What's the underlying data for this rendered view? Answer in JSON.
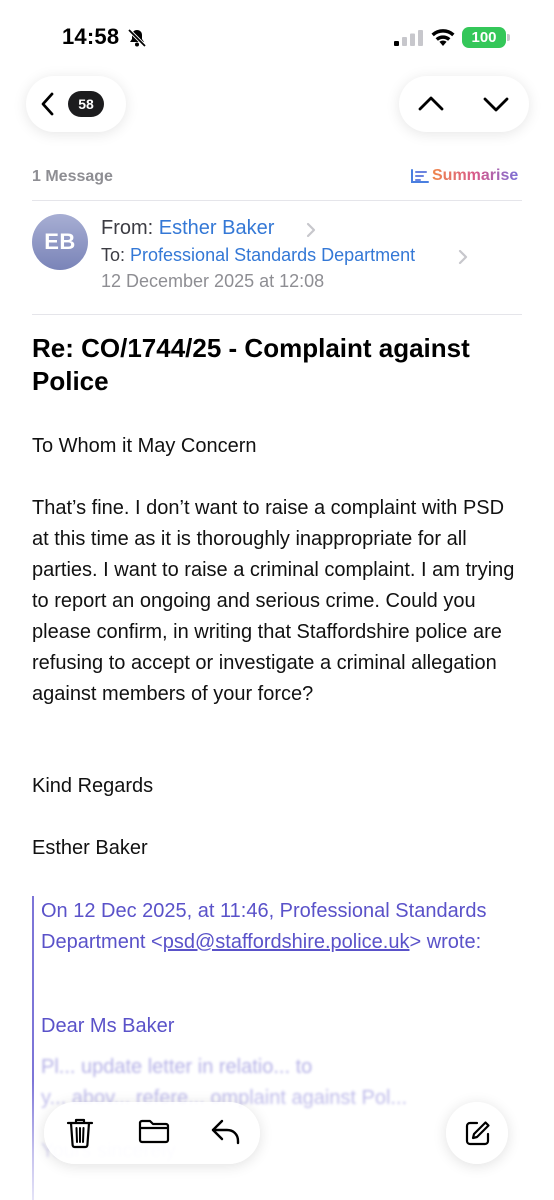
{
  "status_bar": {
    "time": "14:58",
    "battery": "100",
    "icons": [
      "bell-slash-icon",
      "cellular-signal-icon",
      "wifi-icon",
      "battery-icon"
    ],
    "battery_color": "#34c759"
  },
  "nav": {
    "unread_count": "58",
    "icons": [
      "chevron-left-icon",
      "chevron-up-icon",
      "chevron-down-icon"
    ]
  },
  "thread": {
    "message_count": "1 Message",
    "summarise_label": "Summarise"
  },
  "message": {
    "avatar_initials": "EB",
    "from_label": "From:",
    "from_name": "Esther Baker",
    "to_label": "To:",
    "to_name": "Professional Standards Department",
    "date": "12 December 2025 at 12:08",
    "subject": "Re: CO/1744/25 - Complaint against Police",
    "greeting": "To Whom it May Concern",
    "paragraph": "That’s fine. I don’t want to raise a complaint with PSD at this time as it is thoroughly inappropriate for all parties. I want to raise a criminal complaint. I am trying to report an ongoing and serious crime. Could you please confirm, in writing that Staffordshire police are refusing to accept or investigate a criminal allegation against members of your force?",
    "signoff": "Kind Regards",
    "signature": "Esther Baker"
  },
  "quoted": {
    "header_prefix": "On 12 Dec 2025, at 11:46, Professional Standards Department <",
    "email": "psd@staffordshire.police.uk",
    "header_suffix": "> wrote:",
    "greeting": "Dear Ms Baker",
    "line1": "Pl...                    update letter in relatio... to",
    "line2": "y...    abov...  refere...  omplaint against Pol...",
    "closing": "Yours sincerely"
  },
  "toolbar": {
    "icons": [
      "trash-icon",
      "folder-icon",
      "reply-icon",
      "compose-icon"
    ]
  },
  "colors": {
    "link": "#3478d6",
    "quote": "#5a52c9",
    "quote_bar": "#7d75d8"
  }
}
